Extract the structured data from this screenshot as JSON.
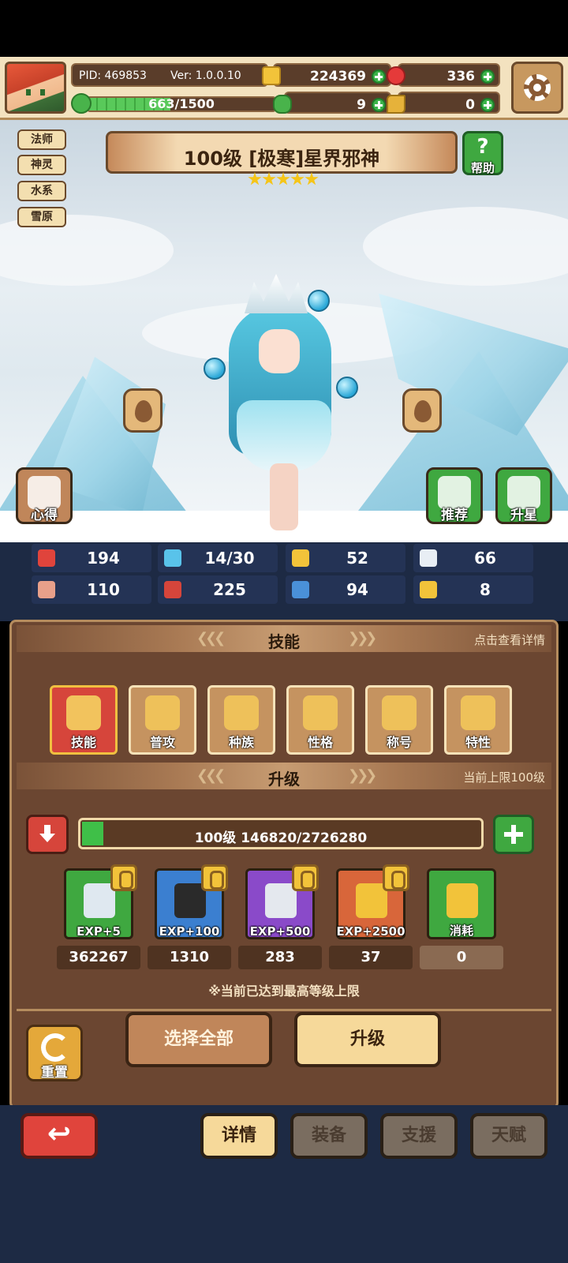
{
  "header": {
    "pid": "PID: 469853",
    "version": "Ver: 1.0.0.10",
    "coins": "224369",
    "gems": "336",
    "clovers": "9",
    "keys": "0",
    "energy_text": "663/1500",
    "energy_fraction": 0.442
  },
  "tags": [
    "法师",
    "神灵",
    "水系",
    "雪原"
  ],
  "character": {
    "title": "100级 [极寒]星界邪神",
    "stars": 5
  },
  "scene_buttons": {
    "help": "帮助",
    "notes": "心得",
    "recommend": "推荐",
    "star_up": "升星"
  },
  "stats": [
    {
      "icon": "heart-icon",
      "value": "194",
      "color": "#e0443c"
    },
    {
      "icon": "water-drop-icon",
      "value": "14/30",
      "color": "#59c3ea"
    },
    {
      "icon": "shield-icon",
      "value": "52",
      "color": "#f2c33a"
    },
    {
      "icon": "wing-icon",
      "value": "66",
      "color": "#e8eef4"
    },
    {
      "icon": "fist-icon",
      "value": "110",
      "color": "#e8a08a"
    },
    {
      "icon": "book-icon",
      "value": "225",
      "color": "#d6453b"
    },
    {
      "icon": "boot-icon",
      "value": "94",
      "color": "#4a90d9"
    },
    {
      "icon": "horseshoe-icon",
      "value": "8",
      "color": "#f2c33a"
    }
  ],
  "skills_section": {
    "title": "技能",
    "hint": "点击查看详情",
    "items": [
      "技能",
      "普攻",
      "种族",
      "性格",
      "称号",
      "特性"
    ]
  },
  "upgrade_section": {
    "title": "升级",
    "hint": "当前上限100级",
    "level_text": "100级  146820/2726280",
    "progress_fraction": 0.054,
    "items": [
      {
        "label": "EXP+5",
        "count": "362267",
        "color": "#3fa840",
        "gem": "#dfe8f0"
      },
      {
        "label": "EXP+100",
        "count": "1310",
        "color": "#3b7fd0",
        "gem": "#2a2a2a"
      },
      {
        "label": "EXP+500",
        "count": "283",
        "color": "#8a4ac9",
        "gem": "#e4e8ee"
      },
      {
        "label": "EXP+2500",
        "count": "37",
        "color": "#d8663a",
        "gem": "#f2c33a"
      },
      {
        "label": "消耗",
        "count": "0",
        "color": "#3fa840",
        "gem": "#f2c33a"
      }
    ],
    "note": "※当前已达到最高等级上限"
  },
  "actions": {
    "reset": "重置",
    "select_all": "选择全部",
    "upgrade": "升级"
  },
  "nav": {
    "tabs": [
      "详情",
      "装备",
      "支援",
      "天赋"
    ]
  }
}
